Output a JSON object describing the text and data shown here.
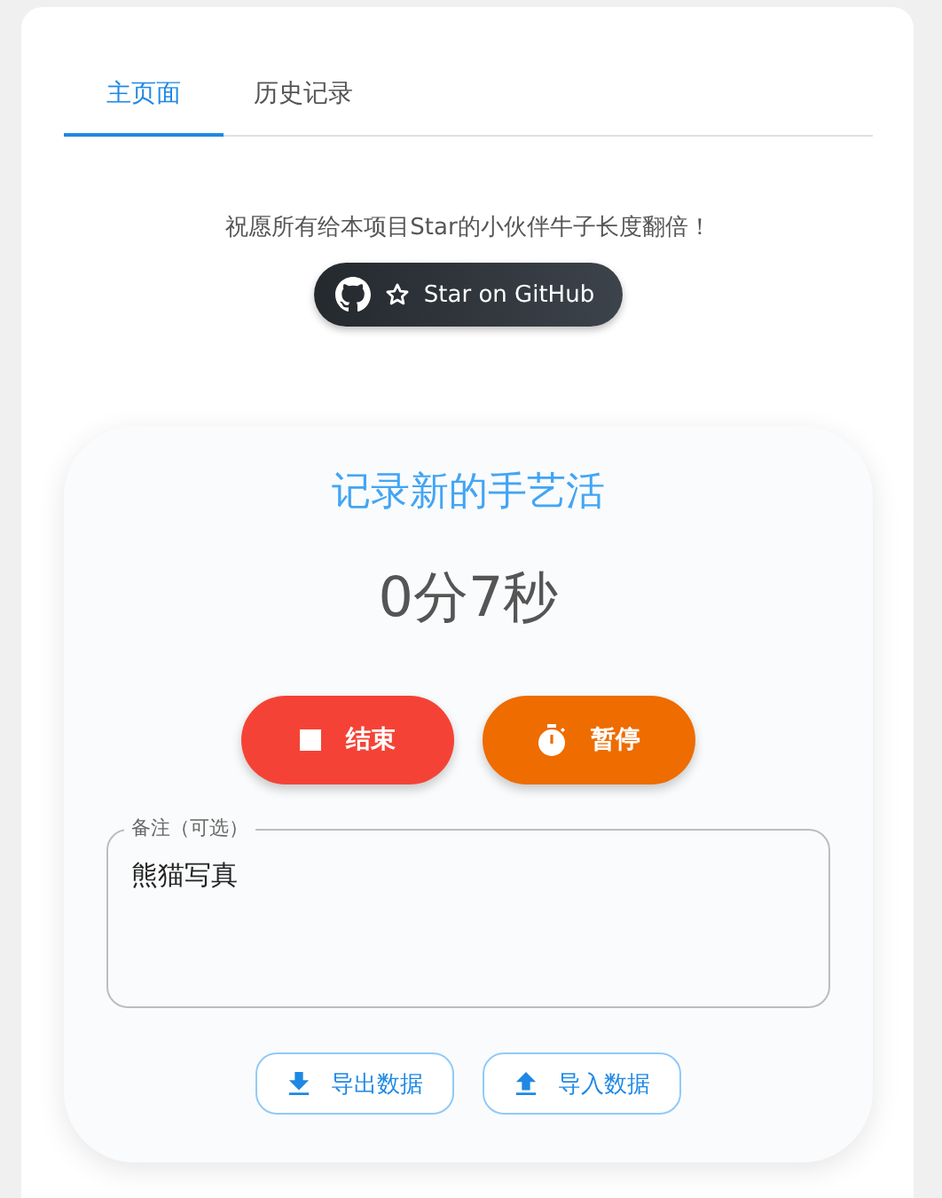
{
  "tabs": [
    {
      "label": "主页面",
      "selected": true
    },
    {
      "label": "历史记录",
      "selected": false
    }
  ],
  "message": "祝愿所有给本项目Star的小伙伴牛子长度翻倍！",
  "github_button": {
    "label": "Star on GitHub"
  },
  "recorder": {
    "title": "记录新的手艺活",
    "timer": "0分7秒",
    "actions": [
      {
        "kind": "stop",
        "label": "结束"
      },
      {
        "kind": "pause",
        "label": "暂停"
      }
    ],
    "note": {
      "label": "备注（可选）",
      "value": "熊猫写真"
    },
    "data_buttons": [
      {
        "kind": "export",
        "label": "导出数据"
      },
      {
        "kind": "import",
        "label": "导入数据"
      }
    ]
  }
}
